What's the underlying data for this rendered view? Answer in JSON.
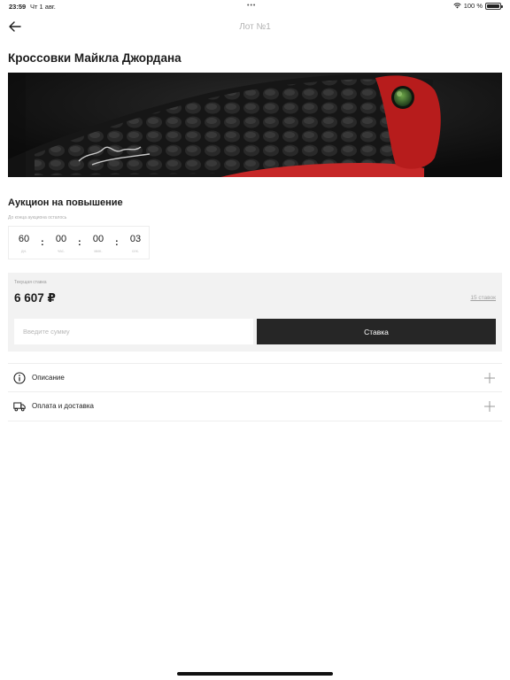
{
  "status_bar": {
    "time": "23:59",
    "date": "Чт 1 авг.",
    "dots": "•••",
    "battery": "100 %"
  },
  "nav": {
    "title": "Лот №1",
    "back_icon": "arrow-left-icon"
  },
  "lot": {
    "title": "Кроссовки Майкла Джордана",
    "image_alt": "sneaker-photo"
  },
  "auction": {
    "heading": "Аукцион на повышение",
    "countdown_caption": "До конца аукциона осталось",
    "countdown": [
      {
        "value": "60",
        "unit": "дн."
      },
      {
        "value": "00",
        "unit": "час."
      },
      {
        "value": "00",
        "unit": "мин."
      },
      {
        "value": "03",
        "unit": "сек."
      }
    ],
    "separator": ":"
  },
  "bid": {
    "caption": "Текущая ставка",
    "amount": "6 607 ₽",
    "bids_link": "15 ставок",
    "input_placeholder": "Введите сумму",
    "input_value": "",
    "button_label": "Ставка"
  },
  "sections": [
    {
      "label": "Описание",
      "icon": "info-icon"
    },
    {
      "label": "Оплата и доставка",
      "icon": "truck-icon"
    }
  ],
  "colors": {
    "accent_dark": "#262626",
    "panel_bg": "#f2f2f2",
    "muted_text": "#b3b3b3"
  }
}
